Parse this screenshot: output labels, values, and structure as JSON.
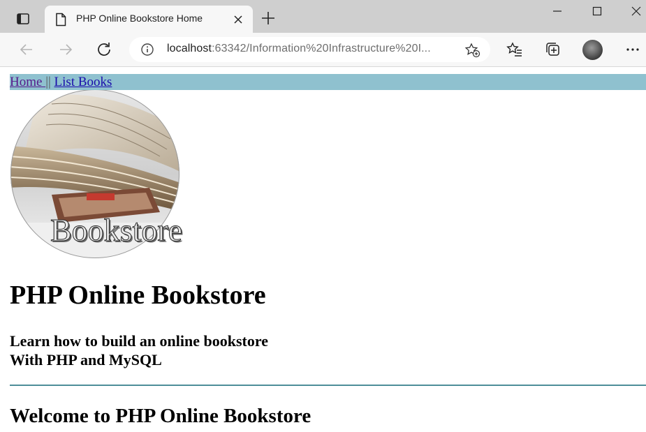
{
  "browser": {
    "tab_title": "PHP Online Bookstore Home",
    "url_host": "localhost",
    "url_rest": ":63342/Information%20Infrastructure%20I...",
    "accent": "#cfcfcf"
  },
  "icons": {
    "tab_actions": "tab-actions-icon",
    "favicon": "page-icon",
    "close": "close-icon",
    "new_tab": "plus-icon",
    "minimize": "minimize-icon",
    "maximize": "maximize-icon",
    "window_close": "close-icon",
    "back": "back-arrow-icon",
    "forward": "forward-arrow-icon",
    "reload": "reload-icon",
    "info": "info-icon",
    "add_favorite": "star-add-icon",
    "favorites": "favorites-icon",
    "collections": "collections-icon",
    "more": "more-icon"
  },
  "nav": {
    "home": "Home ",
    "separator": "||",
    "list_books": "List Books",
    "bar_color": "#8fc1cf"
  },
  "logo": {
    "text": "Bookstore"
  },
  "content": {
    "title": "PHP Online Bookstore",
    "subtitle_line1": "Learn how to build an online bookstore",
    "subtitle_line2": "With PHP and MySQL",
    "welcome": "Welcome to PHP Online Bookstore",
    "rule_color": "#4d8e99"
  }
}
